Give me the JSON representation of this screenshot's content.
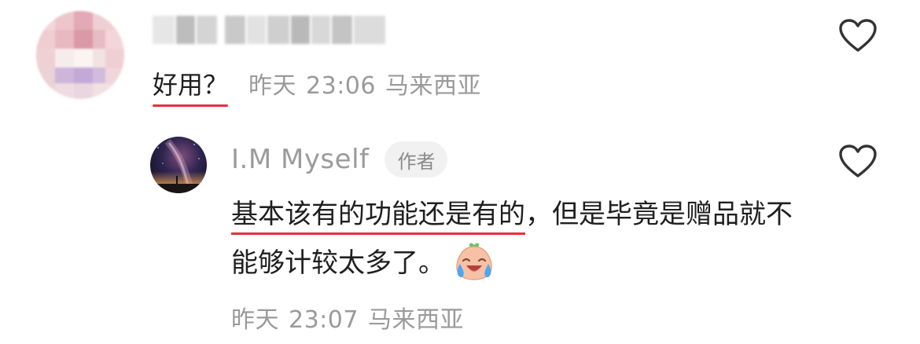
{
  "comment": {
    "text": "好用？",
    "date": "昨天",
    "time": "23:06",
    "location": "马来西亚"
  },
  "reply": {
    "username": "I.M Myself",
    "badge": "作者",
    "text_highlight": "基本该有的功能还是有的",
    "text_rest": "，但是毕竟是赠品就不能够计较太多了。",
    "emoji": "crying-laughing-bun-emoji",
    "date": "昨天",
    "time": "23:07",
    "location": "马来西亚"
  },
  "colors": {
    "underline": "#e4303d",
    "meta_text": "#9a9a9a",
    "badge_bg": "#f1f1f1"
  },
  "icons": {
    "like": "heart-outline-icon"
  }
}
